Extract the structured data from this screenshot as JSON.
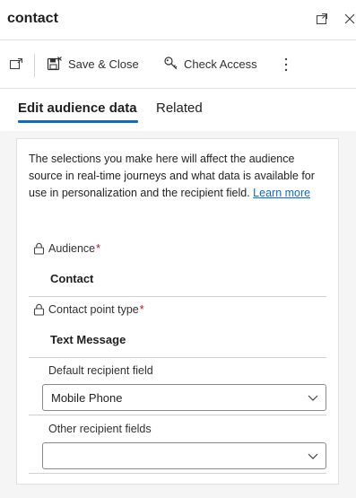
{
  "window": {
    "title": "contact",
    "expand_icon": "expand-icon",
    "close_icon": "close-icon"
  },
  "toolbar": {
    "open_icon": "open-record-icon",
    "save_close_label": "Save & Close",
    "save_close_icon": "save-close-icon",
    "check_access_label": "Check Access",
    "check_access_icon": "check-access-icon",
    "more_icon": "more-vertical-icon"
  },
  "tabs": [
    {
      "label": "Edit audience data",
      "active": true
    },
    {
      "label": "Related",
      "active": false
    }
  ],
  "panel": {
    "description": "The selections you make here will affect the audience source in real-time journeys and what data is available for use in personalization and the recipient field.",
    "learn_more": "Learn more"
  },
  "fields": {
    "audience": {
      "label": "Audience",
      "required_mark": "*",
      "value": "Contact",
      "lock_icon": "lock-icon"
    },
    "contact_point_type": {
      "label": "Contact point type",
      "required_mark": "*",
      "value": "Text Message",
      "lock_icon": "lock-icon"
    },
    "default_recipient": {
      "label": "Default recipient field",
      "value": "Mobile Phone"
    },
    "other_recipients": {
      "label": "Other recipient fields",
      "value": ""
    }
  },
  "colors": {
    "accent": "#0f6cbd",
    "required": "#c50f1f",
    "panel_bg": "#f5f5f5"
  }
}
